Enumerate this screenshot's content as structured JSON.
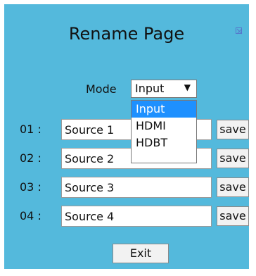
{
  "title": "Rename Page",
  "mode": {
    "label": "Mode",
    "selected": "Input",
    "options": [
      "Input",
      "HDMI",
      "HDBT"
    ]
  },
  "rows": [
    {
      "label": "01 :",
      "value": "Source 1"
    },
    {
      "label": "02 :",
      "value": "Source 2"
    },
    {
      "label": "03 :",
      "value": "Source 3"
    },
    {
      "label": "04 :",
      "value": "Source 4"
    }
  ],
  "save_label": "save",
  "exit_label": "Exit",
  "colors": {
    "panel_bg": "#54b9dc",
    "highlight": "#1e90ff"
  }
}
